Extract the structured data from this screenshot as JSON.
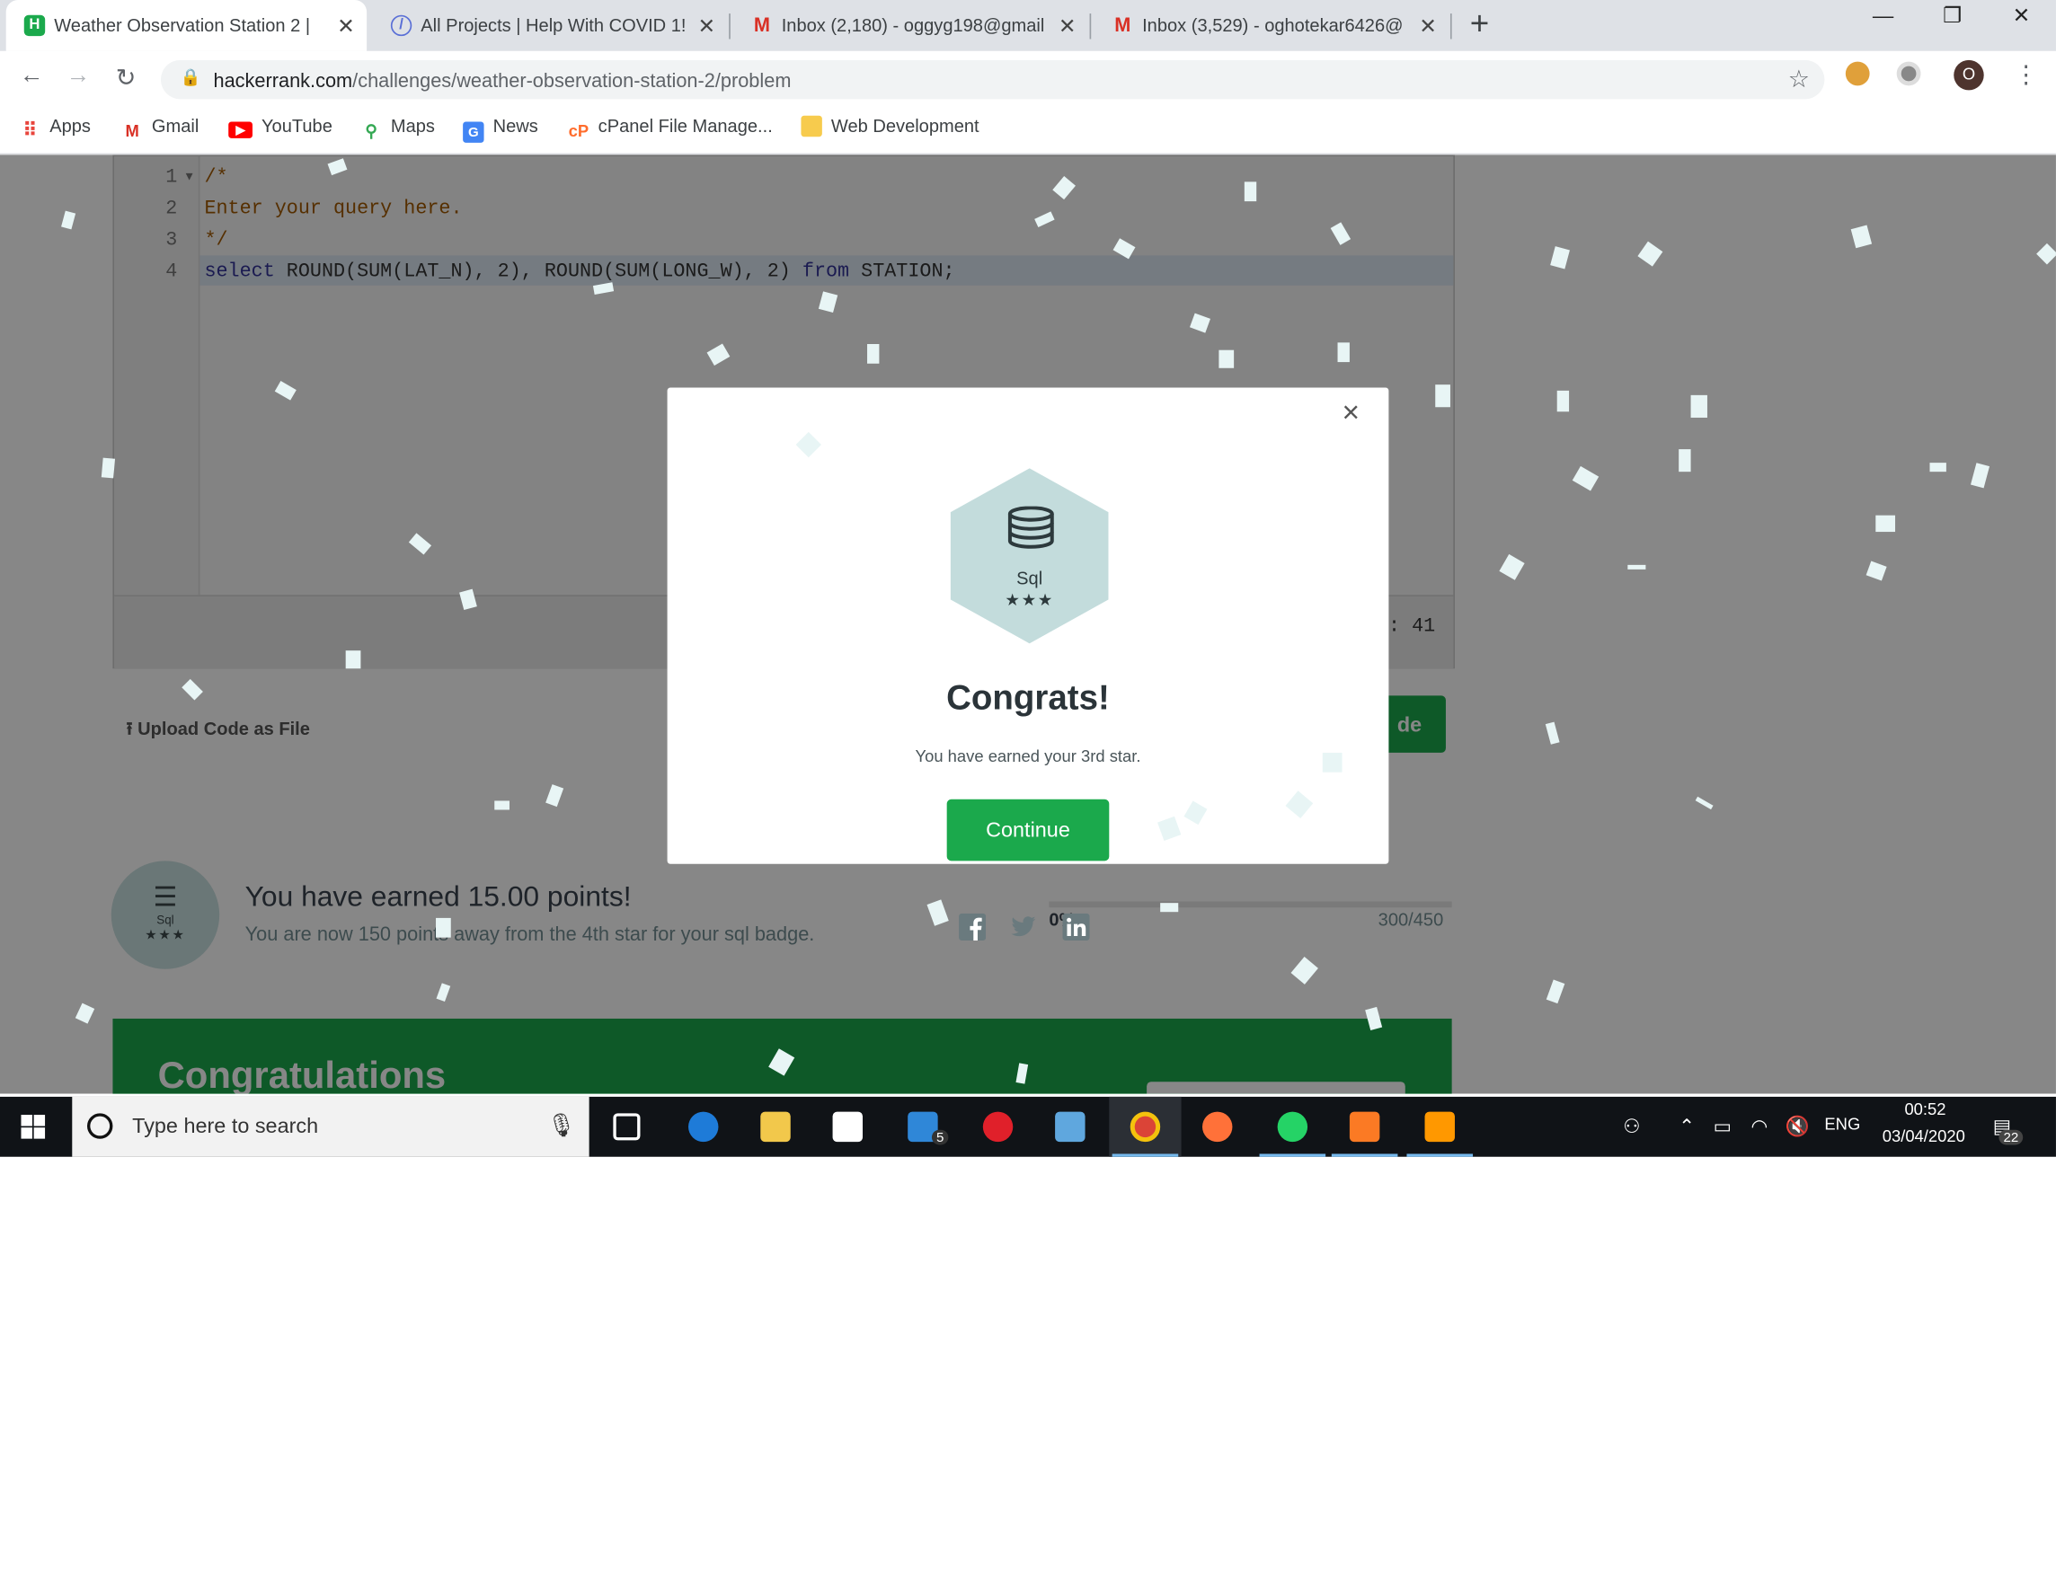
{
  "browser": {
    "tabs": [
      {
        "title": "Weather Observation Station 2 | ",
        "icon": "hackerrank-icon",
        "active": true
      },
      {
        "title": "All Projects | Help With COVID 1!",
        "icon": "helpwithcovid-icon",
        "active": false
      },
      {
        "title": "Inbox (2,180) - oggyg198@gmail",
        "icon": "gmail-icon",
        "active": false
      },
      {
        "title": "Inbox (3,529) - oghotekar6426@",
        "icon": "gmail-icon",
        "active": false
      }
    ],
    "new_tab_label": "+",
    "url_domain": "hackerrank.com",
    "url_path": "/challenges/weather-observation-station-2/problem",
    "profile_initial": "O",
    "bookmarks": [
      {
        "label": "Apps",
        "icon": "apps-grid-icon"
      },
      {
        "label": "Gmail",
        "icon": "gmail-icon"
      },
      {
        "label": "YouTube",
        "icon": "youtube-icon"
      },
      {
        "label": "Maps",
        "icon": "maps-pin-icon"
      },
      {
        "label": "News",
        "icon": "news-icon"
      },
      {
        "label": "cPanel File Manage...",
        "icon": "cpanel-icon"
      },
      {
        "label": "Web Development",
        "icon": "folder-icon"
      }
    ]
  },
  "editor": {
    "line_numbers": [
      "1",
      "2",
      "3",
      "4"
    ],
    "lines": {
      "l1": "/*",
      "l2": "Enter your query here.",
      "l3": "*/",
      "l4_kw1": "select",
      "l4_a": " ROUND(SUM(LAT_N), 2), ROUND(SUM(LONG_W), 2) ",
      "l4_kw2": "from",
      "l4_b": " STATION;"
    },
    "status_fragment": ": 41"
  },
  "page": {
    "upload_label": "Upload Code as File",
    "submit_label_fragment": "de",
    "badge_name": "Sql",
    "badge_stars": "★★★",
    "earned_text": "You have earned 15.00 points!",
    "away_text": "You are now 150 points away from the 4th star for your sql badge.",
    "progress_label": "0%",
    "progress_value": "300/450",
    "progress_fraction": 0.0,
    "banner_title": "Congratulations"
  },
  "modal": {
    "badge_icon": "database-icon",
    "badge_name": "Sql",
    "badge_stars": "★★★",
    "title": "Congrats!",
    "message": "You have earned your 3rd star.",
    "continue_label": "Continue",
    "close_label": "×",
    "social": [
      "facebook-icon",
      "twitter-icon",
      "linkedin-icon"
    ]
  },
  "taskbar": {
    "search_placeholder": "Type here to search",
    "mail_badge": "5",
    "language": "ENG",
    "time": "00:52",
    "date": "03/04/2020",
    "notification_count": "22"
  },
  "colors": {
    "accent_green": "#1ba94c",
    "overlay": "rgba(0,0,0,0.47)",
    "confetti": "#e8f5f5",
    "badge_teal": "#c9e0e0"
  }
}
